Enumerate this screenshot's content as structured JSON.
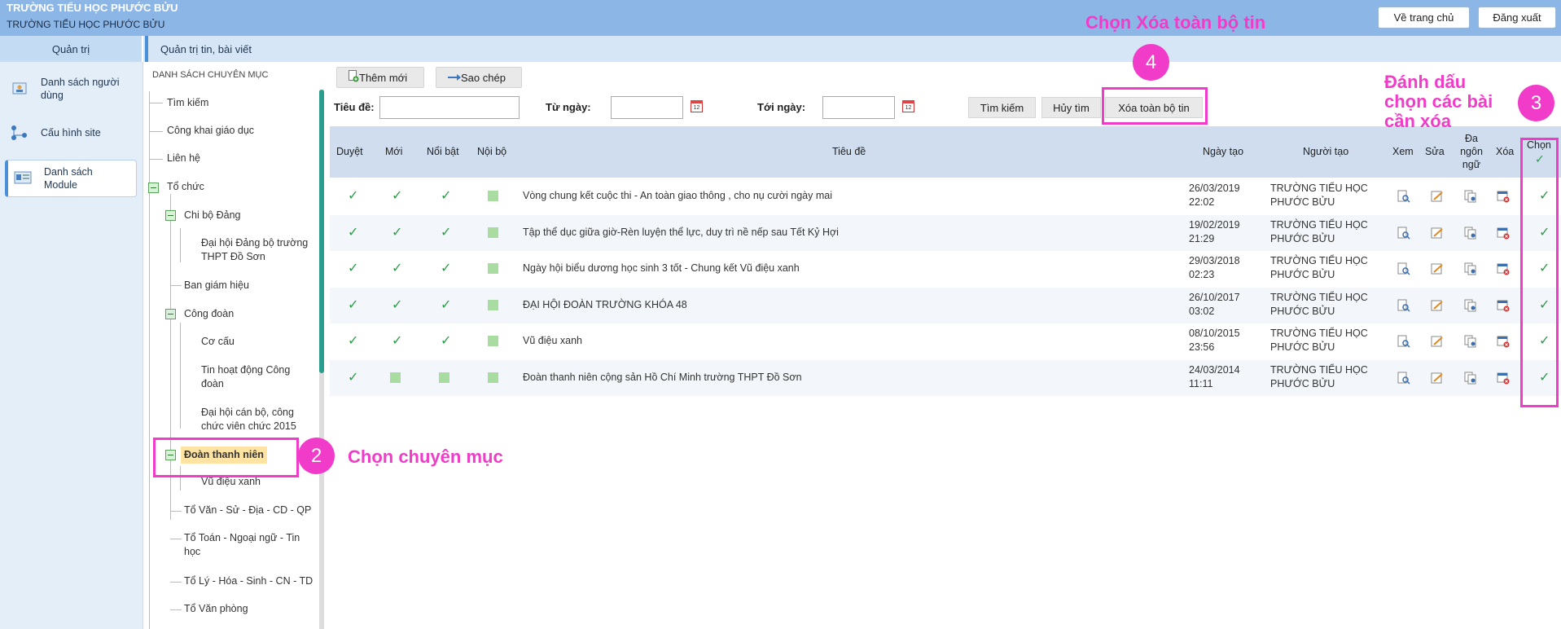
{
  "header": {
    "school_name_top": "TRƯỜNG TIỂU HỌC PHƯỚC BỬU",
    "school_name_sub": "TRƯỜNG TIỂU HỌC PHƯỚC BỬU",
    "home_button": "Về trang chủ",
    "logout_button": "Đăng xuất"
  },
  "subheader": {
    "admin_label": "Quản trị",
    "page_title": "Quản trị tin, bài viết"
  },
  "sidebar": {
    "items": [
      {
        "label": "Danh sách người dùng",
        "icon": "user-list-icon"
      },
      {
        "label": "Cấu hình site",
        "icon": "network-config-icon"
      },
      {
        "label": "Danh sách Module",
        "icon": "module-list-icon",
        "active": true
      }
    ]
  },
  "tree": {
    "title": "DANH SÁCH CHUYÊN MỤC",
    "nodes": {
      "tim_kiem": "Tìm kiếm",
      "cong_khai": "Công khai giáo dục",
      "lien_he": "Liên hệ",
      "to_chuc": "Tổ chức",
      "chi_bo": "Chi bộ Đảng",
      "dai_hoi_dang_bo": "Đại hội Đảng bộ trường THPT Đồ Sơn",
      "ban_giam_hieu": "Ban giám hiệu",
      "cong_doan": "Công đoàn",
      "co_cau": "Cơ cấu",
      "tin_hoat_dong": "Tin hoạt động Công đoàn",
      "dai_hoi_can_bo": "Đại hội cán bộ, công chức viên chức 2015",
      "doan_thanh_nien": "Đoàn thanh niên",
      "vu_dieu_xanh": "Vũ điệu xanh",
      "to_van": "Tổ Văn - Sử - Địa - CD - QP",
      "to_toan": "Tổ Toán - Ngoại ngữ - Tin học",
      "to_ly": "Tổ Lý - Hóa - Sinh - CN - TD",
      "to_van_phong": "Tổ Văn phòng"
    }
  },
  "toolbar": {
    "add_new": "Thêm mới",
    "copy": "Sao chép"
  },
  "filters": {
    "title_label": "Tiêu đề:",
    "from_label": "Từ ngày:",
    "to_label": "Tới ngày:",
    "calendar_day": "12",
    "search_button": "Tìm kiếm",
    "cancel_button": "Hủy tìm",
    "delete_all_button": "Xóa toàn bộ tin"
  },
  "table": {
    "headers": {
      "duyet": "Duyệt",
      "moi": "Mới",
      "noi_bat": "Nổi bật",
      "noi_bo": "Nội bộ",
      "tieu_de": "Tiêu đề",
      "ngay_tao": "Ngày tạo",
      "nguoi_tao": "Người tạo",
      "xem": "Xem",
      "sua": "Sửa",
      "da_ngon_ngu_1": "Đa",
      "da_ngon_ngu_2": "ngôn",
      "da_ngon_ngu_3": "ngữ",
      "xoa": "Xóa",
      "chon": "Chọn",
      "check_all_mark": "✓"
    },
    "check_mark": "✓",
    "rows": [
      {
        "duyet": true,
        "moi": true,
        "noi_bat": true,
        "title": "Vòng chung kết cuộc thi - An toàn giao thông , cho nụ cười ngày mai",
        "date": "26/03/2019",
        "time": "22:02",
        "creator_1": "TRƯỜNG TIỂU HỌC",
        "creator_2": "PHƯỚC BỬU"
      },
      {
        "duyet": true,
        "moi": true,
        "noi_bat": true,
        "title": "Tập thể dục giữa giờ-Rèn luyện thể lực, duy trì nề nếp sau Tết Kỷ Hợi",
        "date": "19/02/2019",
        "time": "21:29",
        "creator_1": "TRƯỜNG TIỂU HỌC",
        "creator_2": "PHƯỚC BỬU"
      },
      {
        "duyet": true,
        "moi": true,
        "noi_bat": true,
        "title": "Ngày hội biểu dương học sinh 3 tốt - Chung kết Vũ điệu xanh",
        "date": "29/03/2018",
        "time": "02:23",
        "creator_1": "TRƯỜNG TIỂU HỌC",
        "creator_2": "PHƯỚC BỬU"
      },
      {
        "duyet": true,
        "moi": true,
        "noi_bat": true,
        "title": "ĐẠI HỘI ĐOÀN TRƯỜNG KHÓA 48",
        "date": "26/10/2017",
        "time": "03:02",
        "creator_1": "TRƯỜNG TIỂU HỌC",
        "creator_2": "PHƯỚC BỬU"
      },
      {
        "duyet": true,
        "moi": true,
        "noi_bat": true,
        "title": "Vũ điệu xanh",
        "date": "08/10/2015",
        "time": "23:56",
        "creator_1": "TRƯỜNG TIỂU HỌC",
        "creator_2": "PHƯỚC BỬU"
      },
      {
        "duyet": true,
        "moi": false,
        "noi_bat": false,
        "title": "Đoàn thanh niên cộng sản Hồ Chí Minh trường THPT Đồ Sơn",
        "date": "24/03/2014",
        "time": "11:11",
        "creator_1": "TRƯỜNG TIỂU HỌC",
        "creator_2": "PHƯỚC BỬU"
      }
    ]
  },
  "annotations": {
    "step4_text": "Chọn Xóa toàn bộ tin",
    "step4_num": "4",
    "step3_line1": "Đánh dấu",
    "step3_line2": "chọn các bài",
    "step3_line3": "cần xóa",
    "step3_num": "3",
    "step2_num": "2",
    "step2_text": "Chọn chuyên mục",
    "color": "#f03cc8"
  }
}
